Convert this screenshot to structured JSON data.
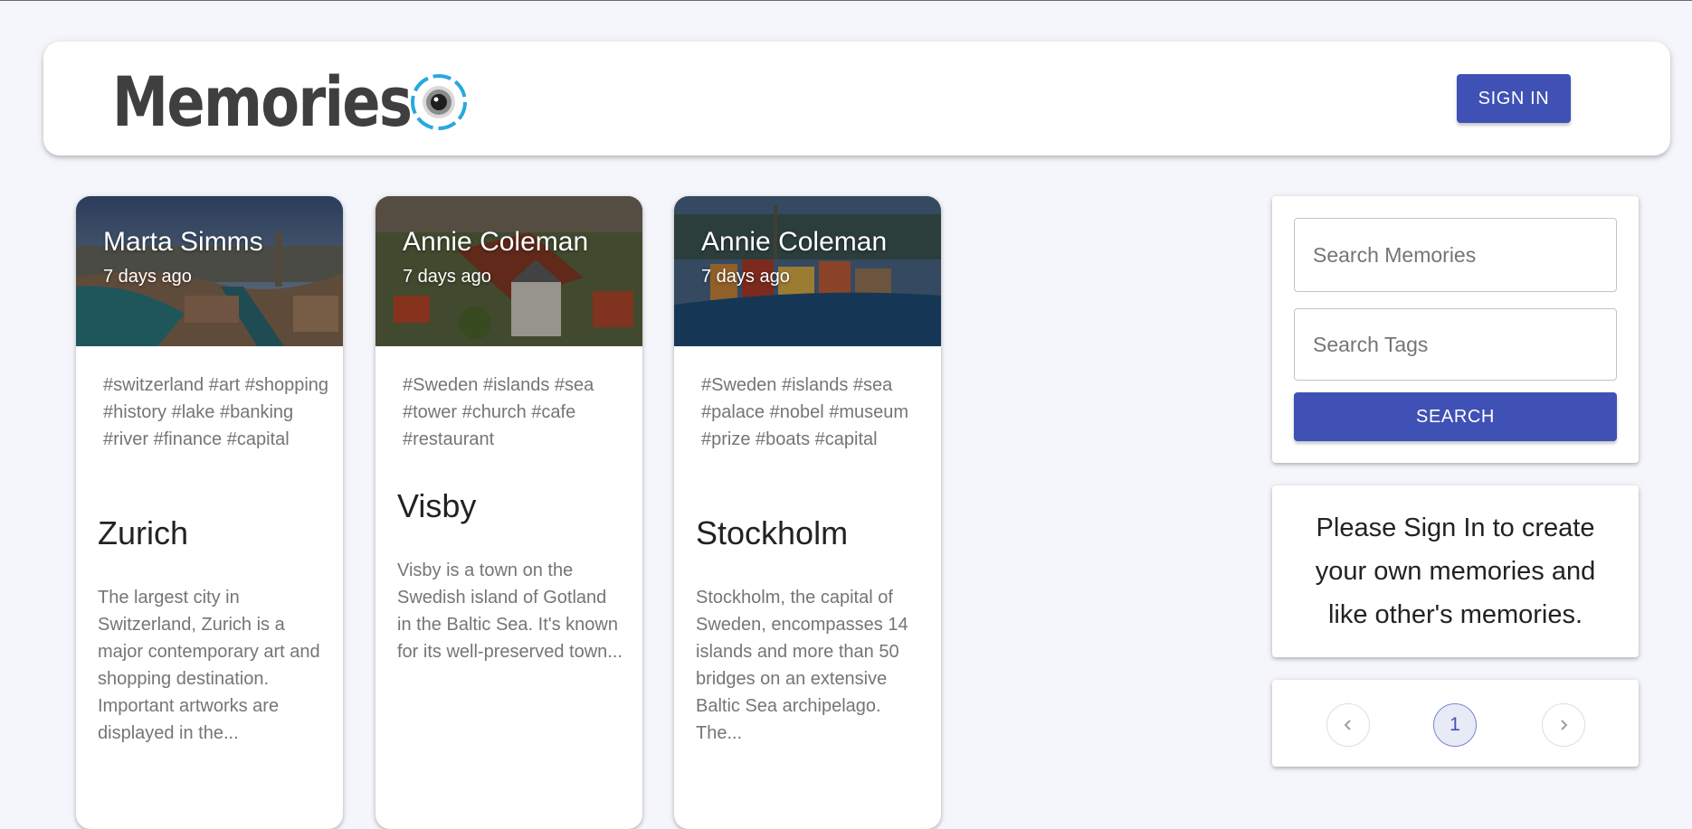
{
  "appbar": {
    "title": "Memories",
    "signin_label": "SIGN IN"
  },
  "cards": [
    {
      "author": "Marta Simms",
      "time": "7 days ago",
      "tags": "#switzerland #art #shopping #history #lake #banking #river #finance #capital",
      "title": "Zurich",
      "message": "The largest city in Switzerland, Zurich is a major contemporary art and shopping destination. Important artworks are displayed in the..."
    },
    {
      "author": "Annie Coleman",
      "time": "7 days ago",
      "tags": "#Sweden #islands #sea #tower #church #cafe #restaurant",
      "title": "Visby",
      "message": "Visby is a town on the Swedish island of Gotland in the Baltic Sea. It's known for its well-preserved town..."
    },
    {
      "author": "Annie Coleman",
      "time": "7 days ago",
      "tags": "#Sweden #islands #sea #palace #nobel #museum #prize #boats #capital",
      "title": "Stockholm",
      "message": "Stockholm, the capital of Sweden, encompasses 14 islands and more than 50 bridges on an extensive Baltic Sea archipelago. The..."
    }
  ],
  "search": {
    "memories_placeholder": "Search Memories",
    "tags_placeholder": "Search Tags",
    "button_label": "SEARCH"
  },
  "info": {
    "message": "Please Sign In to create your own memories and like other's memories."
  },
  "pagination": {
    "current_page": "1",
    "prev_icon": "chevron-left-icon",
    "next_icon": "chevron-right-icon"
  },
  "colors": {
    "primary": "#3f51b5",
    "background": "#f5f6fb",
    "logo_ring": "#29a8dd"
  }
}
